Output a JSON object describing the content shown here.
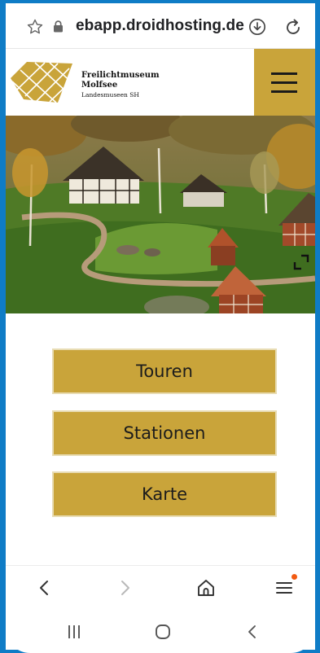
{
  "browser": {
    "url": "ebapp.droidhosting.de",
    "icons": [
      "star-icon",
      "lock-icon",
      "download-icon",
      "reload-icon"
    ]
  },
  "site": {
    "logo": {
      "line1": "Freilichtmuseum",
      "line2": "Molfsee",
      "line3": "Landesmuseen SH"
    },
    "accent_color": "#c9a43a",
    "menu_icon": "hamburger-icon"
  },
  "main": {
    "hero_image": "museum-village-photo",
    "buttons": [
      {
        "label": "Touren"
      },
      {
        "label": "Stationen"
      },
      {
        "label": "Karte"
      }
    ]
  },
  "toolbar": {
    "icons": [
      "back-icon",
      "forward-icon",
      "home-icon",
      "menu-icon"
    ],
    "notification_color": "#f25a12"
  },
  "android_nav": {
    "icons": [
      "recents-icon",
      "home-circle-icon",
      "back-chevron-icon"
    ]
  }
}
